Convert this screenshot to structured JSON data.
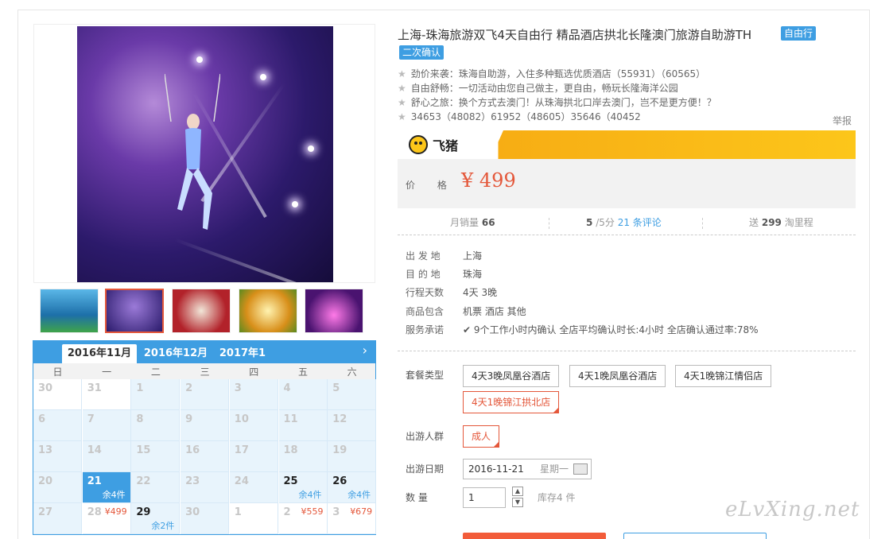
{
  "product": {
    "title": "上海-珠海旅游双飞4天自由行 精品酒店拱北长隆澳门旅游自助游TH",
    "tag_primary": "自由行",
    "tag_secondary": "二次确认",
    "features": [
      "劲价来袭：珠海自助游，入住多种甄选优质酒店（55931）（60565）",
      "自由舒畅：一切活动由您自己做主，更自由，畅玩长隆海洋公园",
      "舒心之旅：换个方式去澳门！从珠海拱北口岸去澳门，岂不是更方便！？",
      "34653（48082）61952（48605）35646（40452"
    ],
    "report_label": "举报"
  },
  "brand": {
    "name": "飞猪"
  },
  "price": {
    "label": "价 格",
    "value": "¥ 499"
  },
  "stats": {
    "monthly_sales_label": "月销量",
    "monthly_sales": "66",
    "rating": "5",
    "rating_suffix": "/5分",
    "reviews": "21 条评论",
    "points_prefix": "送",
    "points": "299",
    "points_suffix": "淘里程"
  },
  "info": [
    {
      "key": "出 发 地",
      "value": "上海"
    },
    {
      "key": "目 的 地",
      "value": "珠海"
    },
    {
      "key": "行程天数",
      "value": "4天 3晚"
    },
    {
      "key": "商品包含",
      "value": "机票  酒店  其他"
    },
    {
      "key": "服务承诺",
      "value": "9个工作小时内确认    全店平均确认时长:4小时    全店确认通过率:78%"
    }
  ],
  "options": {
    "package_label": "套餐类型",
    "packages": [
      "4天3晚凤凰谷酒店",
      "4天1晚凤凰谷酒店",
      "4天1晚锦江情侣店",
      "4天1晚锦江拱北店"
    ],
    "traveler_label": "出游人群",
    "traveler": "成人",
    "date_label": "出游日期",
    "date_value": "2016-11-21",
    "date_weekday": "星期一",
    "qty_label": "数  量",
    "qty_value": "1",
    "stock": "库存4 件"
  },
  "calendar": {
    "tabs": [
      "2016年11月",
      "2016年12月",
      "2017年1月"
    ],
    "weekdays": [
      "日",
      "一",
      "二",
      "三",
      "四",
      "五",
      "六"
    ],
    "rows": [
      [
        {
          "d": "30",
          "s": "white"
        },
        {
          "d": "31",
          "s": "white"
        },
        {
          "d": "1"
        },
        {
          "d": "2"
        },
        {
          "d": "3"
        },
        {
          "d": "4"
        },
        {
          "d": "5"
        }
      ],
      [
        {
          "d": "6"
        },
        {
          "d": "7"
        },
        {
          "d": "8"
        },
        {
          "d": "9"
        },
        {
          "d": "10"
        },
        {
          "d": "11"
        },
        {
          "d": "12"
        }
      ],
      [
        {
          "d": "13"
        },
        {
          "d": "14"
        },
        {
          "d": "15"
        },
        {
          "d": "16"
        },
        {
          "d": "17"
        },
        {
          "d": "18"
        },
        {
          "d": "19"
        }
      ],
      [
        {
          "d": "20"
        },
        {
          "d": "21",
          "s": "sel",
          "rest": "余4件"
        },
        {
          "d": "22"
        },
        {
          "d": "23"
        },
        {
          "d": "24"
        },
        {
          "d": "25",
          "s": "avail",
          "rest": "余4件"
        },
        {
          "d": "26",
          "s": "avail",
          "rest": "余4件"
        }
      ],
      [
        {
          "d": "27"
        },
        {
          "d": "28",
          "s": "white",
          "pr": "¥499"
        },
        {
          "d": "29",
          "s": "avail",
          "rest": "余2件"
        },
        {
          "d": "30"
        },
        {
          "d": "1",
          "s": "white"
        },
        {
          "d": "2",
          "s": "white",
          "pr": "¥559"
        },
        {
          "d": "3",
          "s": "white",
          "pr": "¥679"
        }
      ]
    ]
  },
  "watermark": "eLvXing.net"
}
